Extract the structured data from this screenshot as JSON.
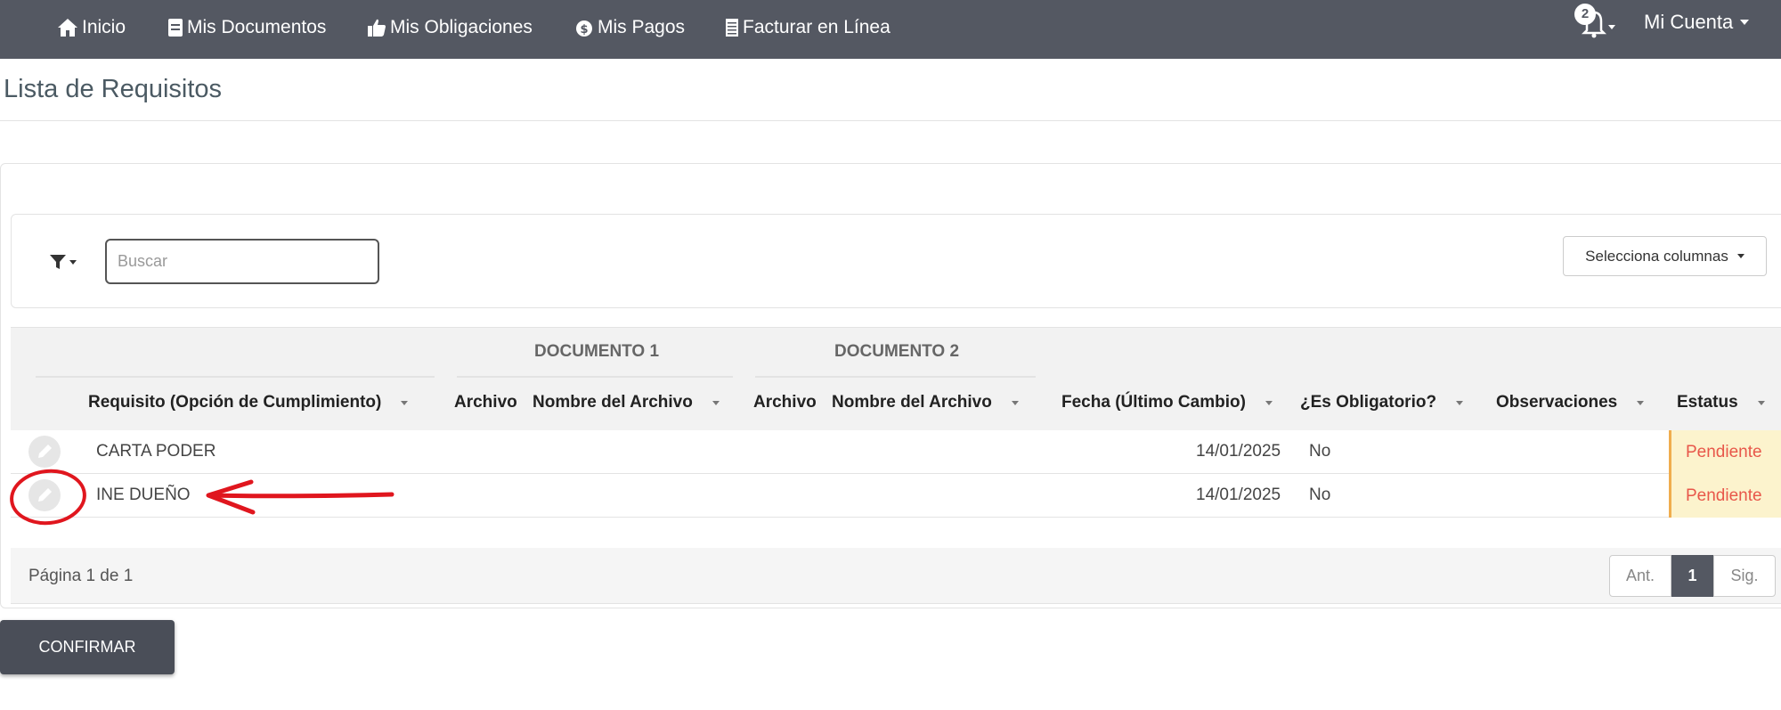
{
  "nav": {
    "items": [
      {
        "label": "Inicio",
        "icon": "home-icon"
      },
      {
        "label": "Mis Documentos",
        "icon": "document-icon"
      },
      {
        "label": "Mis Obligaciones",
        "icon": "thumbs-up-icon"
      },
      {
        "label": "Mis Pagos",
        "icon": "money-bag-icon"
      },
      {
        "label": "Facturar en Línea",
        "icon": "receipt-icon"
      }
    ],
    "notifications_count": "2",
    "account_label": "Mi Cuenta"
  },
  "page": {
    "title": "Lista de Requisitos"
  },
  "toolbar": {
    "search_placeholder": "Buscar",
    "columns_label": "Selecciona columnas"
  },
  "table": {
    "groups": [
      "DOCUMENTO 1",
      "DOCUMENTO 2"
    ],
    "headers": {
      "requisito": "Requisito (Opción de Cumplimiento)",
      "archivo1": "Archivo",
      "nombre1": "Nombre del Archivo",
      "archivo2": "Archivo",
      "nombre2": "Nombre del Archivo",
      "fecha": "Fecha (Último Cambio)",
      "obligatorio": "¿Es Obligatorio?",
      "observaciones": "Observaciones",
      "estatus": "Estatus"
    },
    "rows": [
      {
        "requisito": "CARTA PODER",
        "fecha": "14/01/2025",
        "obligatorio": "No",
        "estatus": "Pendiente"
      },
      {
        "requisito": "INE DUEÑO",
        "fecha": "14/01/2025",
        "obligatorio": "No",
        "estatus": "Pendiente"
      }
    ]
  },
  "pagination": {
    "text": "Página 1 de 1",
    "prev": "Ant.",
    "current": "1",
    "next": "Sig."
  },
  "actions": {
    "confirm": "CONFIRMAR"
  },
  "colors": {
    "navbar": "#545862",
    "status_pending_bg": "#fcf3cd",
    "status_pending_text": "#e8574a",
    "annotation": "#e0161e"
  }
}
